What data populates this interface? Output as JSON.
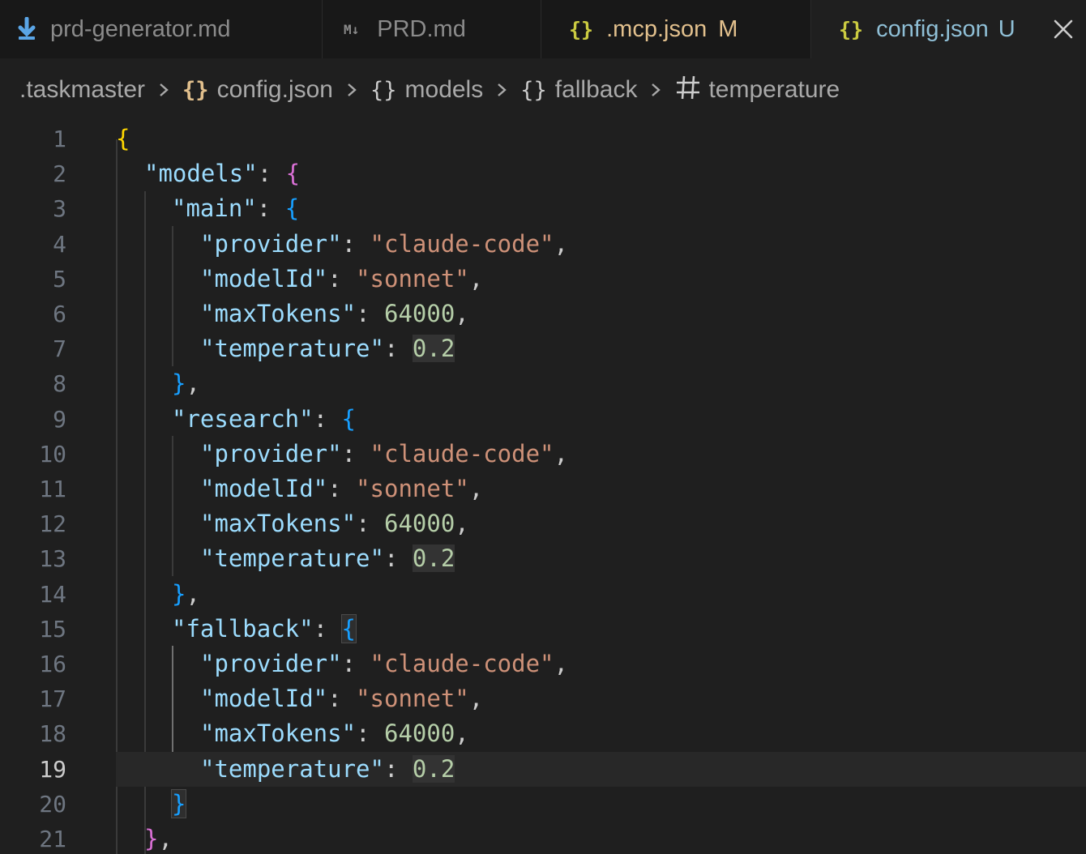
{
  "tabs": [
    {
      "label": "prd-generator.md",
      "icon": "download-icon",
      "status": ""
    },
    {
      "label": "PRD.md",
      "icon": "markdown-icon",
      "icon_text": "M↓",
      "status": ""
    },
    {
      "label": ".mcp.json",
      "icon": "json-braces-icon",
      "icon_text": "{}",
      "status": "M"
    },
    {
      "label": "config.json",
      "icon": "json-braces-icon",
      "icon_text": "{}",
      "status": "U"
    }
  ],
  "breadcrumb": {
    "folder": ".taskmaster",
    "file": "config.json",
    "file_icon": "{}",
    "models": "models",
    "fallback": "fallback",
    "obj_icon": "{}",
    "property": "temperature",
    "property_icon": "#"
  },
  "editor": {
    "current_line": 19,
    "line_numbers": [
      "1",
      "2",
      "3",
      "4",
      "5",
      "6",
      "7",
      "8",
      "9",
      "10",
      "11",
      "12",
      "13",
      "14",
      "15",
      "16",
      "17",
      "18",
      "19",
      "20",
      "21"
    ],
    "root_open": "{",
    "models_key": "\"models\"",
    "main_key": "\"main\"",
    "research_key": "\"research\"",
    "fallback_key": "\"fallback\"",
    "provider_key": "\"provider\"",
    "modelId_key": "\"modelId\"",
    "maxTokens_key": "\"maxTokens\"",
    "temperature_key": "\"temperature\"",
    "provider_value": "\"claude-code\"",
    "modelId_value": "\"sonnet\"",
    "maxTokens_value": "64000",
    "temperature_value": "0.2"
  },
  "colors": {
    "background": "#1f1f1f",
    "tab_bar": "#181818",
    "key": "#9cdcfe",
    "string": "#ce9178",
    "number": "#b5cea8",
    "bracket_level1": "#ffd700",
    "bracket_level2": "#da70d6",
    "bracket_level3": "#179fff",
    "modified": "#e2c08d",
    "untracked": "#73c991"
  }
}
